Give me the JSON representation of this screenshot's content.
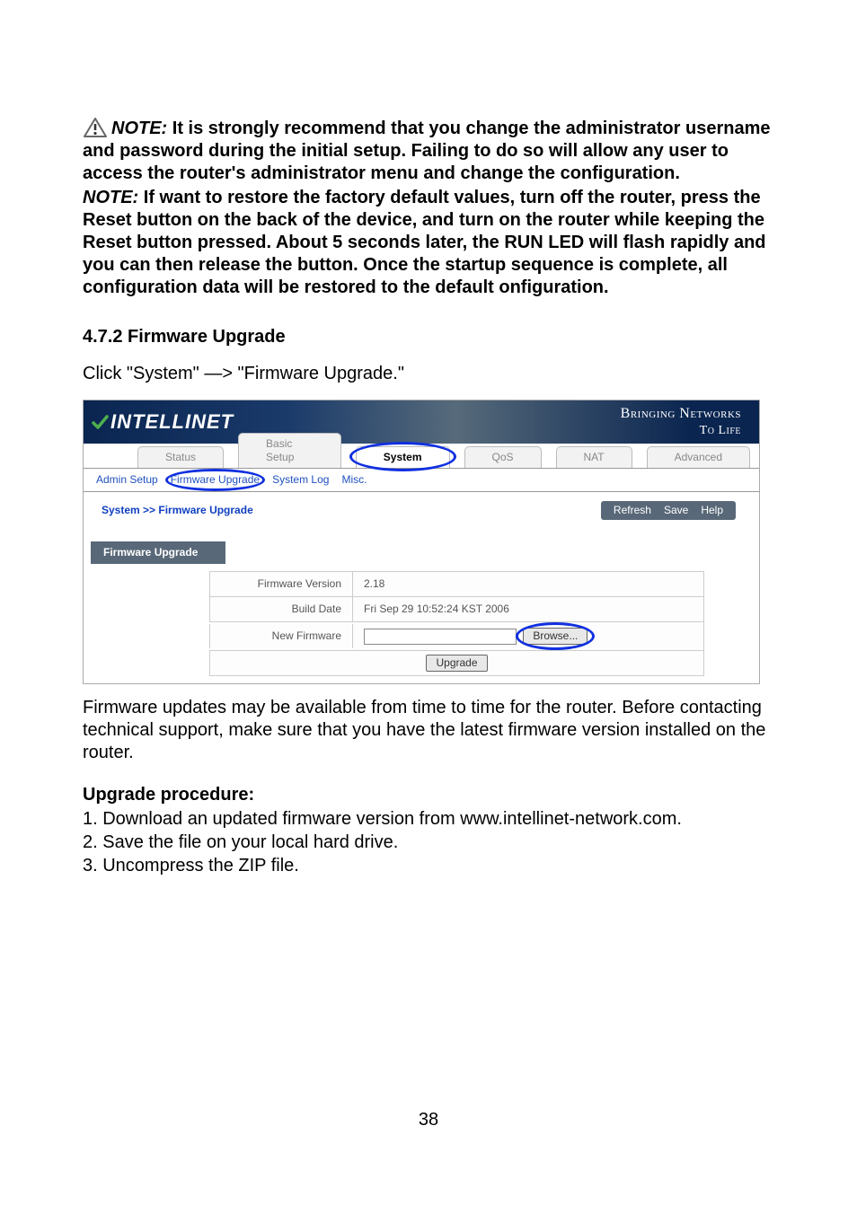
{
  "note1": {
    "label": "NOTE:",
    "text": "It is strongly recommend that you change the administrator username and password during the initial setup. Failing to do so will allow any user to access the router's administrator menu and change the configuration."
  },
  "note2": {
    "label": "NOTE:",
    "text": "If want to restore the factory default values, turn off the router, press the Reset button on the back of the device, and turn on the router while keeping the Reset button pressed. About 5 seconds later, the RUN LED will flash rapidly and you can then release the button. Once the startup sequence is complete, all configuration data will be restored to the default onfiguration."
  },
  "section_heading": "4.7.2 Firmware Upgrade",
  "click_instruction": "Click \"System\" —> \"Firmware Upgrade.\"",
  "screenshot": {
    "logo_text": "INTELLINET",
    "tagline1": "Bringing Networks",
    "tagline2": "To Life",
    "tabs": {
      "status": "Status",
      "basic_setup": "Basic Setup",
      "system": "System",
      "qos": "QoS",
      "nat": "NAT",
      "advanced": "Advanced"
    },
    "subtabs": {
      "admin_setup": "Admin Setup",
      "firmware_upgrade": "Firmware Upgrade",
      "system_log": "System Log",
      "misc": "Misc."
    },
    "breadcrumb": "System >> Firmware Upgrade",
    "actions": {
      "refresh": "Refresh",
      "save": "Save",
      "help": "Help"
    },
    "panel_title": "Firmware Upgrade",
    "rows": {
      "fw_version_label": "Firmware Version",
      "fw_version_value": "2.18",
      "build_date_label": "Build Date",
      "build_date_value": "Fri Sep 29 10:52:24 KST 2006",
      "new_firmware_label": "New Firmware",
      "browse_label": "Browse...",
      "upgrade_label": "Upgrade"
    }
  },
  "para_after": "Firmware updates may be available from time to time for the router. Before contacting technical support, make sure that you have the latest firmware version installed on the router.",
  "procedure_heading": "Upgrade procedure:",
  "steps": {
    "s1": "1. Download an updated firmware version from www.intellinet-network.com.",
    "s2": "2. Save the file on your local hard drive.",
    "s3": "3. Uncompress the ZIP file."
  },
  "page_num": "38"
}
